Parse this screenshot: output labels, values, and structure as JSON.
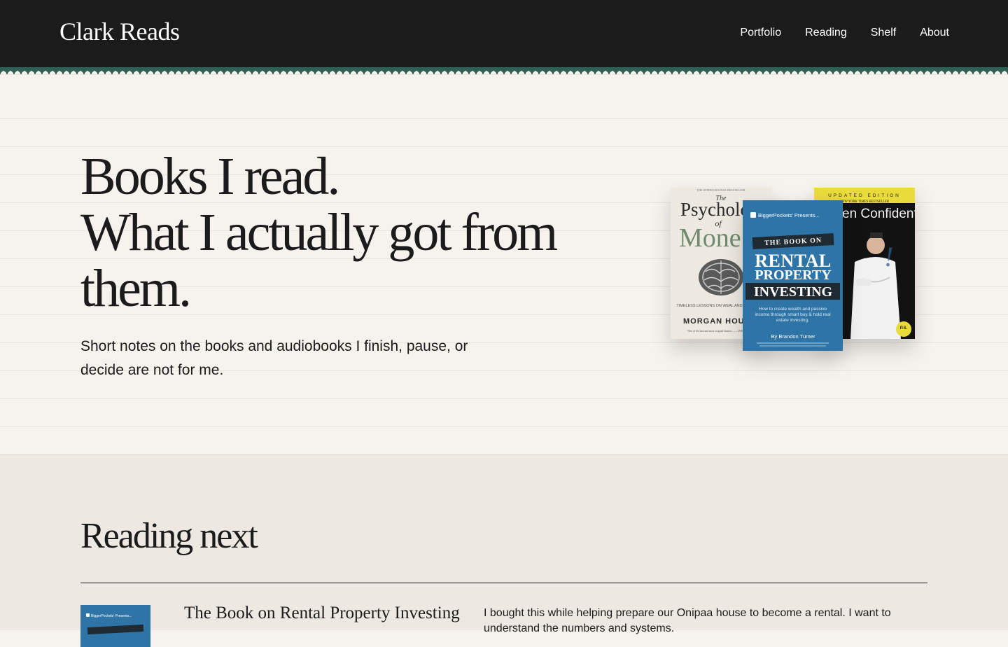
{
  "header": {
    "brand": "Clark Reads",
    "nav": [
      "Portfolio",
      "Reading",
      "Shelf",
      "About"
    ]
  },
  "colors": {
    "header_bg": "#1b1b1b",
    "scallop": "#2f5f55",
    "page_bg": "#f6f3ee",
    "section_bg": "#ede8e1",
    "rental_cover": "#2f74a6"
  },
  "hero": {
    "title_lines": [
      "Books I read.",
      "What I actually got from",
      "them."
    ],
    "subtitle": "Short notes on the books and audiobooks I finish, pause, or decide are not for me."
  },
  "covers": {
    "psychology": {
      "tagline": "THE INTERNATIONAL BESTSELLER",
      "the": "The",
      "title_a": "Psycholo",
      "of": "of",
      "title_b": "Mone",
      "blurb": "TIMELESS LESSONS ON WEAL AND HAPPINESS",
      "author": "MORGAN HOU",
      "quote": "\"One of the best and most original finance... — JASON ZWEIG"
    },
    "rental": {
      "publisher": "BiggerPockets' Presents...",
      "kicker": "THE BOOK ON",
      "line1": "RENTAL",
      "line2": "PROPERTY",
      "line3": "INVESTING",
      "desc": "How to create wealth and passive income through smart buy & hold real estate investing.",
      "author": "By Brandon Turner"
    },
    "kitchen": {
      "edition": "UPDATED EDITION",
      "bestseller": "NEW YORK TIMES BESTSELLER",
      "title": "en Confidential",
      "ps": "P.S."
    }
  },
  "reading_next": {
    "heading": "Reading next",
    "items": [
      {
        "thumb_label": "BiggerPockets' Presents...",
        "title": "The Book on Rental Property Investing",
        "note": "I bought this while helping prepare our Onipaa house to become a rental. I want to understand the numbers and systems."
      }
    ]
  }
}
